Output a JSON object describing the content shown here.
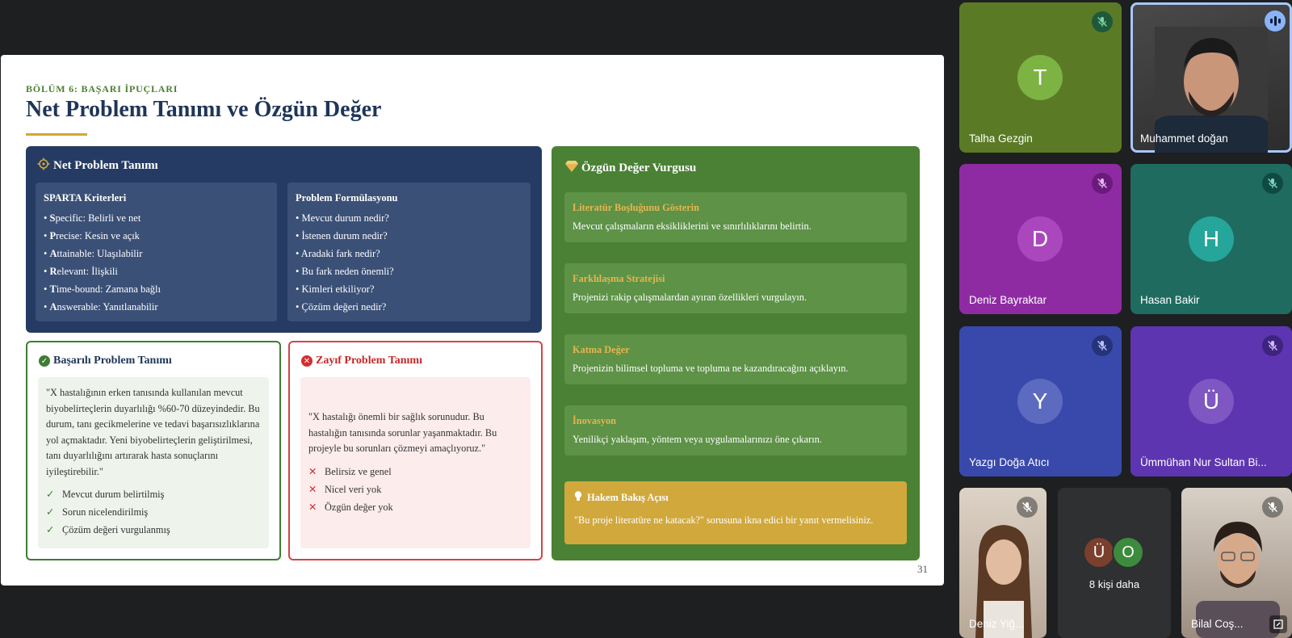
{
  "slide": {
    "section": "BÖLÜM 6: BAŞARI İPUÇLARI",
    "title": "Net Problem Tanımı ve Özgün Değer",
    "page_number": "31",
    "net_problem": {
      "heading": "Net Problem Tanımı",
      "left_card": {
        "title": "SPARTA Kriterleri",
        "items": [
          {
            "bullet": "• ",
            "bold": "S",
            "rest": "pecific: Belirli ve net"
          },
          {
            "bullet": "• ",
            "bold": "P",
            "rest": "recise: Kesin ve açık"
          },
          {
            "bullet": "• ",
            "bold": "A",
            "rest": "ttainable: Ulaşılabilir"
          },
          {
            "bullet": "• ",
            "bold": "R",
            "rest": "elevant: İlişkili"
          },
          {
            "bullet": "• ",
            "bold": "T",
            "rest": "ime-bound: Zamana bağlı"
          },
          {
            "bullet": "• ",
            "bold": "A",
            "rest": "nswerable: Yanıtlanabilir"
          }
        ]
      },
      "right_card": {
        "title": "Problem Formülasyonu",
        "items": [
          "• Mevcut durum nedir?",
          "• İstenen durum nedir?",
          "• Aradaki fark nedir?",
          "• Bu fark neden önemli?",
          "• Kimleri etkiliyor?",
          "• Çözüm değeri nedir?"
        ]
      }
    },
    "success_box": {
      "heading": "Başarılı Problem Tanımı",
      "quote": "\"X hastalığının erken tanısında kullanılan mevcut biyobelirteçlerin duyarlılığı %60-70 düzeyindedir. Bu durum, tanı gecikmelerine ve tedavi başarısızlıklarına yol açmaktadır. Yeni biyobelirteçlerin geliştirilmesi, tanı duyarlılığını artırarak hasta sonuçlarını iyileştirebilir.\"",
      "checks": [
        "Mevcut durum belirtilmiş",
        "Sorun nicelendirilmiş",
        "Çözüm değeri vurgulanmış"
      ]
    },
    "weak_box": {
      "heading": "Zayıf Problem Tanımı",
      "quote": "\"X hastalığı önemli bir sağlık sorunudur. Bu hastalığın tanısında sorunlar yaşanmaktadır. Bu projeyle bu sorunları çözmeyi amaçlıyoruz.\"",
      "crosses": [
        "Belirsiz ve genel",
        "Nicel veri yok",
        "Özgün değer yok"
      ]
    },
    "ozgun_deger": {
      "heading": "Özgün Değer Vurgusu",
      "cards": [
        {
          "title": "Literatür Boşluğunu Gösterin",
          "desc": "Mevcut çalışmaların eksikliklerini ve sınırlılıklarını belirtin."
        },
        {
          "title": "Farklılaşma Stratejisi",
          "desc": "Projenizi rakip çalışmalardan ayıran özellikleri vurgulayın."
        },
        {
          "title": "Katma Değer",
          "desc": "Projenizin bilimsel topluma ve topluma ne kazandıracağını açıklayın."
        },
        {
          "title": "İnovasyon",
          "desc": "Yenilikçi yaklaşım, yöntem veya uygulamalarınızı öne çıkarın."
        }
      ],
      "hakem": {
        "title": "Hakem Bakış Açısı",
        "desc": "\"Bu proje literatüre ne katacak?\" sorusuna ikna edici bir yanıt vermelisiniz."
      }
    }
  },
  "participants": [
    {
      "name": "Talha Gezgin",
      "initial": "T",
      "bg": "#5b7a26",
      "avatar_bg": "#7cb342"
    },
    {
      "name": "Muhammet doğan",
      "initial": "",
      "bg": "#6b6b6b",
      "avatar_bg": ""
    },
    {
      "name": "Deniz Bayraktar",
      "initial": "D",
      "bg": "#8e2ba3",
      "avatar_bg": "#ab47bc"
    },
    {
      "name": "Hasan Bakir",
      "initial": "H",
      "bg": "#1f6b60",
      "avatar_bg": "#26a69a"
    },
    {
      "name": "Yazgı Doğa Atıcı",
      "initial": "Y",
      "bg": "#3949ab",
      "avatar_bg": "#5c6bc0"
    },
    {
      "name": "Ümmühan Nur Sultan Bi...",
      "initial": "Ü",
      "bg": "#5e35b1",
      "avatar_bg": "#7e57c2"
    },
    {
      "name": "Deniz Yiğ...",
      "initial": "",
      "bg": "#c9b8a8",
      "avatar_bg": ""
    },
    {
      "name": "Bilal Coş...",
      "initial": "",
      "bg": "#8c7a6c",
      "avatar_bg": ""
    }
  ],
  "more_tile": {
    "initials": [
      "Ü",
      "O"
    ],
    "colors": [
      "#7b3f2e",
      "#3d8b3d"
    ],
    "label": "8 kişi daha"
  },
  "colors": {
    "background": "#1e1f20",
    "slide_navy": "#253b63",
    "slide_green": "#4a8134",
    "accent_gold": "#d4a738"
  }
}
